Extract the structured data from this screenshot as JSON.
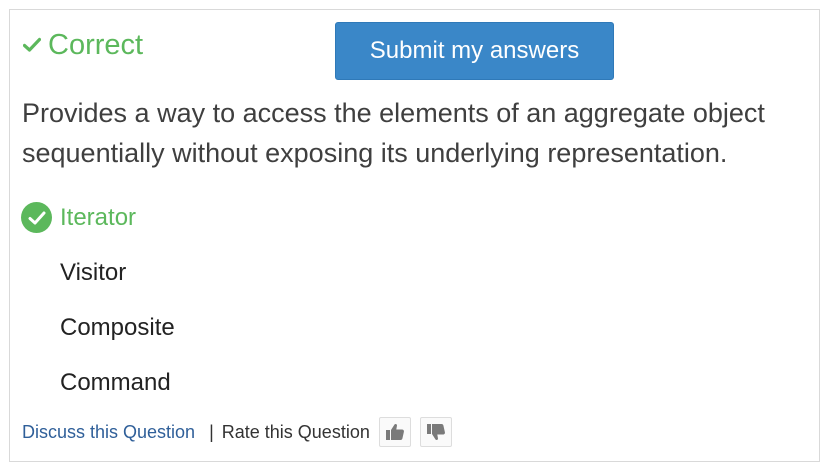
{
  "result": {
    "icon": "check-icon",
    "label": "Correct",
    "color": "#5cb85c"
  },
  "submit": {
    "label": "Submit my answers",
    "color": "#3a87c8"
  },
  "question": {
    "text": "Provides a way to access the elements of an aggregate object sequentially without exposing its underlying representation."
  },
  "options": [
    {
      "label": "Iterator",
      "state": "correct",
      "icon": "check-circle-icon"
    },
    {
      "label": "Visitor",
      "state": "none"
    },
    {
      "label": "Composite",
      "state": "none"
    },
    {
      "label": "Command",
      "state": "none"
    }
  ],
  "footer": {
    "discuss_label": "Discuss this Question",
    "separator": "|",
    "rate_label": "Rate this Question",
    "thumbs_up_icon": "thumbs-up-icon",
    "thumbs_down_icon": "thumbs-down-icon"
  }
}
